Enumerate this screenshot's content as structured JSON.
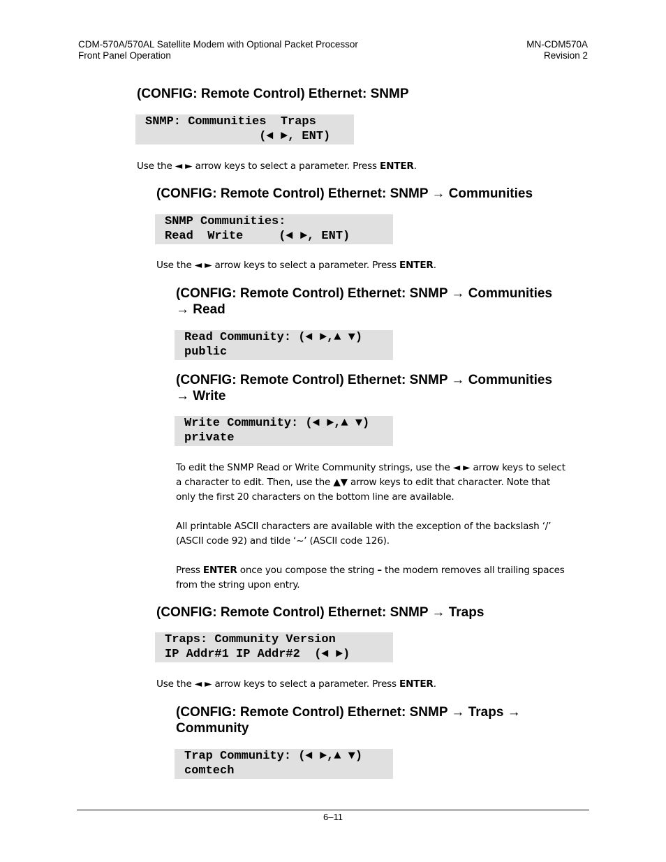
{
  "header": {
    "left_line1": "CDM-570A/570AL Satellite Modem with Optional Packet Processor",
    "left_line2": "Front Panel Operation",
    "right_line1": "MN-CDM570A",
    "right_line2": "Revision 2"
  },
  "sections": [
    {
      "heading": "(CONFIG: Remote Control) Ethernet: SNMP",
      "lcd_line1": "SNMP: Communities  Traps",
      "lcd_line2": "                (◄ ►, ENT)",
      "text_pre": "Use the ◄ ► arrow keys to select a parameter. Press ",
      "text_bold": "ENTER",
      "text_post": "."
    },
    {
      "heading": "(CONFIG: Remote Control) Ethernet: SNMP → Communities",
      "lcd_line1": "SNMP Communities:",
      "lcd_line2": "Read  Write     (◄ ►, ENT)",
      "text_pre": "Use the ◄ ► arrow keys to select a parameter. Press ",
      "text_bold": "ENTER",
      "text_post": "."
    },
    {
      "heading_line1": "(CONFIG: Remote Control) Ethernet: SNMP → Communities",
      "heading_line2": "→ Read",
      "lcd_line1": "Read Community: (◄ ►,▲ ▼)",
      "lcd_line2": "public"
    },
    {
      "heading_line1": "(CONFIG: Remote Control) Ethernet: SNMP → Communities",
      "heading_line2": "→ Write",
      "lcd_line1": "Write Community: (◄ ►,▲ ▼)",
      "lcd_line2": "private",
      "para1_line1": "To edit the SNMP Read or Write Community strings, use the ◄ ► arrow keys to select",
      "para1_line2": "a character to edit. Then, use the ▲▼ arrow keys to edit that character. Note that",
      "para1_line3": "only the first 20 characters on the bottom line are available.",
      "para2_line1": "All printable ASCII characters are available with the exception of the backslash ‘/’",
      "para2_line2": "(ASCII code 92) and tilde ‘~’ (ASCII code 126).",
      "para3_pre": "Press ",
      "para3_bold1": "ENTER",
      "para3_mid": " once you compose the string ",
      "para3_bold2": "–",
      "para3_post": " the modem removes all trailing spaces",
      "para3_line2": "from the string upon entry."
    },
    {
      "heading": "(CONFIG: Remote Control) Ethernet: SNMP → Traps",
      "lcd_line1": "Traps: Community Version",
      "lcd_line2": "IP Addr#1 IP Addr#2  (◄ ►)",
      "text_pre": "Use the ◄ ► arrow keys to select a parameter. Press ",
      "text_bold": "ENTER",
      "text_post": "."
    },
    {
      "heading_line1": "(CONFIG: Remote Control) Ethernet: SNMP → Traps →",
      "heading_line2": "Community",
      "lcd_line1": "Trap Community: (◄ ►,▲ ▼)",
      "lcd_line2": "comtech"
    }
  ],
  "footer": {
    "page_number": "6–11"
  }
}
